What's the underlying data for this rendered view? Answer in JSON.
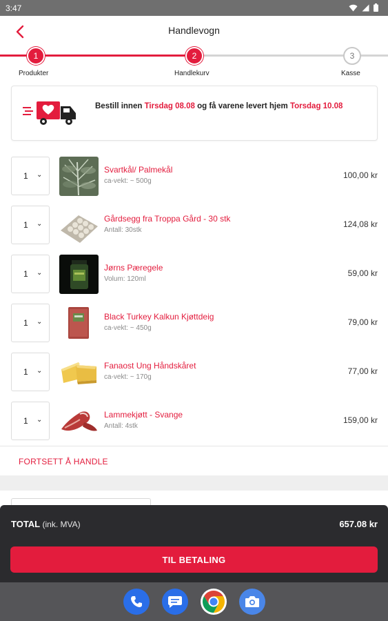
{
  "status_bar": {
    "time": "3:47"
  },
  "header": {
    "title": "Handlevogn"
  },
  "stepper": {
    "steps": [
      {
        "number": "1",
        "label": "Produkter"
      },
      {
        "number": "2",
        "label": "Handlekurv"
      },
      {
        "number": "3",
        "label": "Kasse"
      }
    ],
    "current_step": 2
  },
  "delivery": {
    "text_1": "Bestill innen ",
    "order_by": "Tirsdag 08.08",
    "text_2": " og få varene levert hjem ",
    "deliver_on": "Torsdag 10.08"
  },
  "items": [
    {
      "qty": "1",
      "name": "Svartkål/ Palmekål",
      "sub": "ca-vekt: ~ 500g",
      "price": "100,00 kr",
      "image": "kale"
    },
    {
      "qty": "1",
      "name": "Gårdsegg fra Troppa Gård - 30 stk",
      "sub": "Antall: 30stk",
      "price": "124,08 kr",
      "image": "eggs"
    },
    {
      "qty": "1",
      "name": "Jørns Pæregele",
      "sub": "Volum: 120ml",
      "price": "59,00 kr",
      "image": "jelly-jar"
    },
    {
      "qty": "1",
      "name": "Black Turkey Kalkun Kjøttdeig",
      "sub": "ca-vekt: ~ 450g",
      "price": "79,00 kr",
      "image": "ground-meat"
    },
    {
      "qty": "1",
      "name": "Fanaost Ung Håndskåret",
      "sub": "ca-vekt: ~ 170g",
      "price": "77,00 kr",
      "image": "cheese"
    },
    {
      "qty": "1",
      "name": "Lammekjøtt - Svange",
      "sub": "Antall: 4stk",
      "price": "159,00 kr",
      "image": "lamb-meat"
    }
  ],
  "continue_label": "FORTSETT Å HANDLE",
  "summary": {
    "total_label": "TOTAL",
    "total_note": "(ink. MVA)",
    "total_value": "657.08 kr",
    "pay_label": "TIL BETALING"
  },
  "dock": {
    "apps": [
      "phone-icon",
      "messages-icon",
      "chrome-icon",
      "camera-icon"
    ]
  },
  "colors": {
    "accent": "#e31c3d",
    "panel": "#2b2b2e",
    "step_inactive": "#c8c8c8"
  }
}
